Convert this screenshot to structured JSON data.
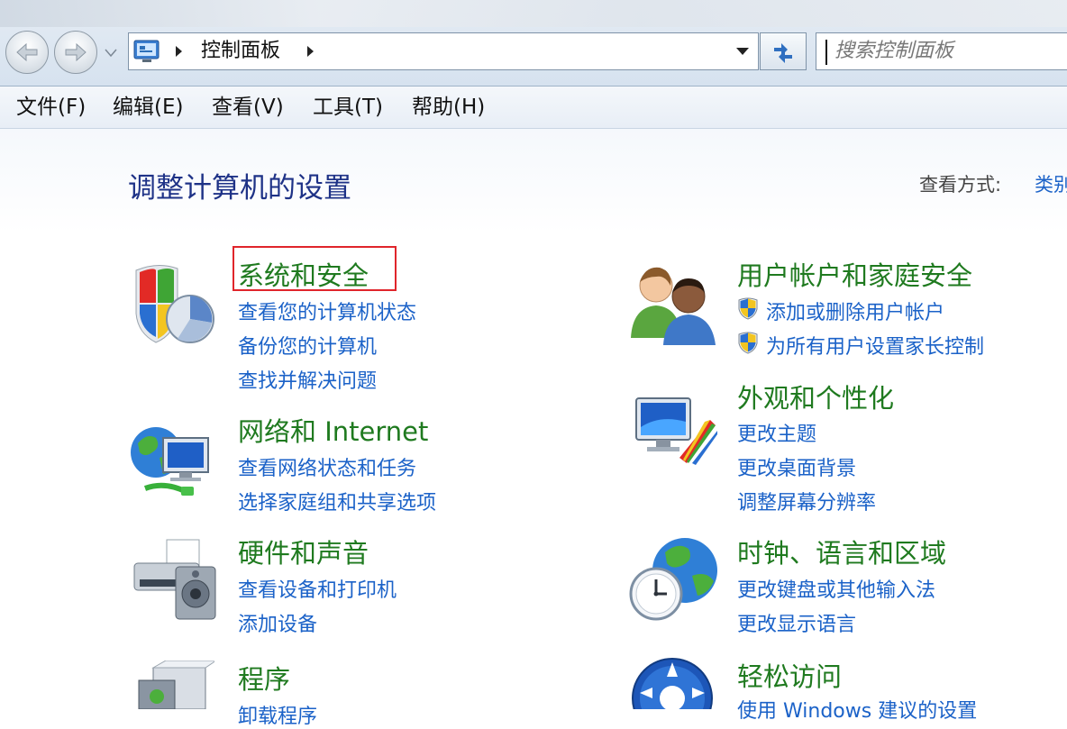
{
  "address": {
    "path": "控制面板"
  },
  "search": {
    "placeholder": "搜索控制面板"
  },
  "menu": [
    "文件(F)",
    "编辑(E)",
    "查看(V)",
    "工具(T)",
    "帮助(H)"
  ],
  "heading": "调整计算机的设置",
  "view": {
    "label": "查看方式:",
    "value": "类别"
  },
  "categories": [
    {
      "title": "系统和安全",
      "icon": "shield-icon",
      "links": [
        "查看您的计算机状态",
        "备份您的计算机",
        "查找并解决问题"
      ]
    },
    {
      "title": "网络和 Internet",
      "icon": "network-globe-icon",
      "links": [
        "查看网络状态和任务",
        "选择家庭组和共享选项"
      ]
    },
    {
      "title": "硬件和声音",
      "icon": "printer-speaker-icon",
      "links": [
        "查看设备和打印机",
        "添加设备"
      ]
    },
    {
      "title": "程序",
      "icon": "programs-box-icon",
      "links": [
        "卸载程序"
      ]
    },
    {
      "title": "用户帐户和家庭安全",
      "icon": "users-icon",
      "links": [
        "添加或删除用户帐户",
        "为所有用户设置家长控制"
      ]
    },
    {
      "title": "外观和个性化",
      "icon": "monitor-palette-icon",
      "links": [
        "更改主题",
        "更改桌面背景",
        "调整屏幕分辨率"
      ]
    },
    {
      "title": "时钟、语言和区域",
      "icon": "clock-globe-icon",
      "links": [
        "更改键盘或其他输入法",
        "更改显示语言"
      ]
    },
    {
      "title": "轻松访问",
      "icon": "ease-of-access-icon",
      "links": [
        "使用 Windows 建议的设置"
      ]
    }
  ],
  "colors": {
    "category_title": "#1f7a1f",
    "link": "#1b62c8",
    "heading": "#1e3287",
    "highlight_box": "#e0252b"
  }
}
